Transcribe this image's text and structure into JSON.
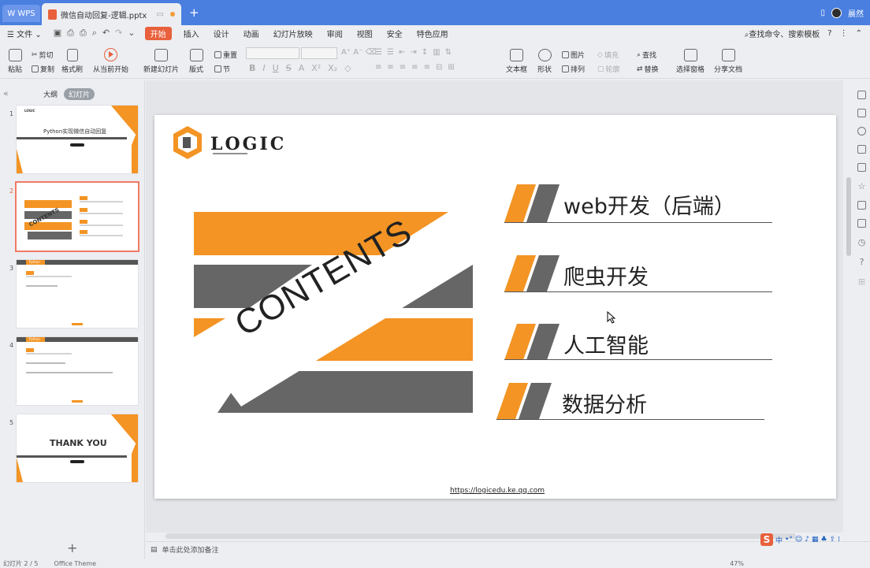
{
  "titlebar": {
    "wps_tab": "WPS",
    "doc_tab": "微信自动回复-逻辑.pptx",
    "user": "晨然"
  },
  "menu": {
    "file": "文件",
    "items": [
      "开始",
      "插入",
      "设计",
      "动画",
      "幻灯片放映",
      "审阅",
      "视图",
      "安全",
      "特色应用"
    ],
    "active": "开始",
    "search": "查找命令、搜索模板"
  },
  "ribbon": {
    "paste": "粘贴",
    "cut": "剪切",
    "copy": "复制",
    "format_painter": "格式刷",
    "from_current": "从当前开始",
    "new_slide": "新建幻灯片",
    "layout": "版式",
    "section": "节",
    "reset": "重置",
    "textbox": "文本框",
    "shape": "形状",
    "picture": "图片",
    "fill": "填充",
    "arrange": "排列",
    "outline": "轮廓",
    "find": "查找",
    "replace": "替换",
    "select_pane": "选择窗格",
    "share": "分享文档"
  },
  "panel": {
    "outline_tab": "大纲",
    "slides_tab": "幻灯片",
    "thumbs": [
      {
        "num": "1",
        "title": "Python实现微信自动回复"
      },
      {
        "num": "2",
        "title": "CONTENTS"
      },
      {
        "num": "3",
        "title": "Python"
      },
      {
        "num": "4",
        "title": "Python"
      },
      {
        "num": "5",
        "title": "THANK YOU"
      }
    ]
  },
  "slide": {
    "logo": "LOGIC",
    "contents": "CONTENTS",
    "items": [
      "web开发（后端）",
      "爬虫开发",
      "人工智能",
      "数据分析"
    ],
    "url": "https://logicedu.ke.qq.com"
  },
  "notes": "单击此处添加备注",
  "status": {
    "slide_info": "幻灯片 2 / 5",
    "theme": "Office Theme",
    "zoom": "47%"
  },
  "colors": {
    "orange": "#f39424",
    "gray": "#666666",
    "accent": "#e8603c"
  }
}
